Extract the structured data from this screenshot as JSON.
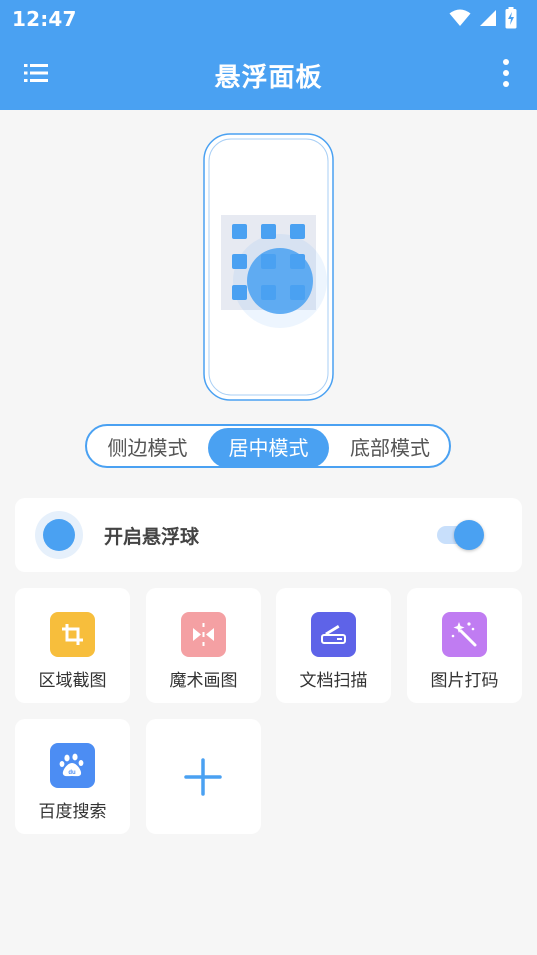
{
  "status_bar": {
    "time": "12:47"
  },
  "app_bar": {
    "title": "悬浮面板"
  },
  "mode_selector": {
    "options": [
      "侧边模式",
      "居中模式",
      "底部模式"
    ],
    "selected": "居中模式"
  },
  "floating_ball": {
    "label": "开启悬浮球",
    "enabled": true
  },
  "tools": [
    {
      "label": "区域截图",
      "icon": "crop-icon",
      "color": "#f7be3c"
    },
    {
      "label": "魔术画图",
      "icon": "magic-draw-icon",
      "color": "#f4a0a3"
    },
    {
      "label": "文档扫描",
      "icon": "scanner-icon",
      "color": "#5e63e8"
    },
    {
      "label": "图片打码",
      "icon": "magic-wand-icon",
      "color": "#c07cf2"
    },
    {
      "label": "百度搜索",
      "icon": "baidu-paw-icon",
      "color": "#4c8df3"
    }
  ],
  "add_tool": {
    "icon": "plus-icon"
  },
  "colors": {
    "accent": "#4aa1f2",
    "background": "#f6f6f6"
  }
}
